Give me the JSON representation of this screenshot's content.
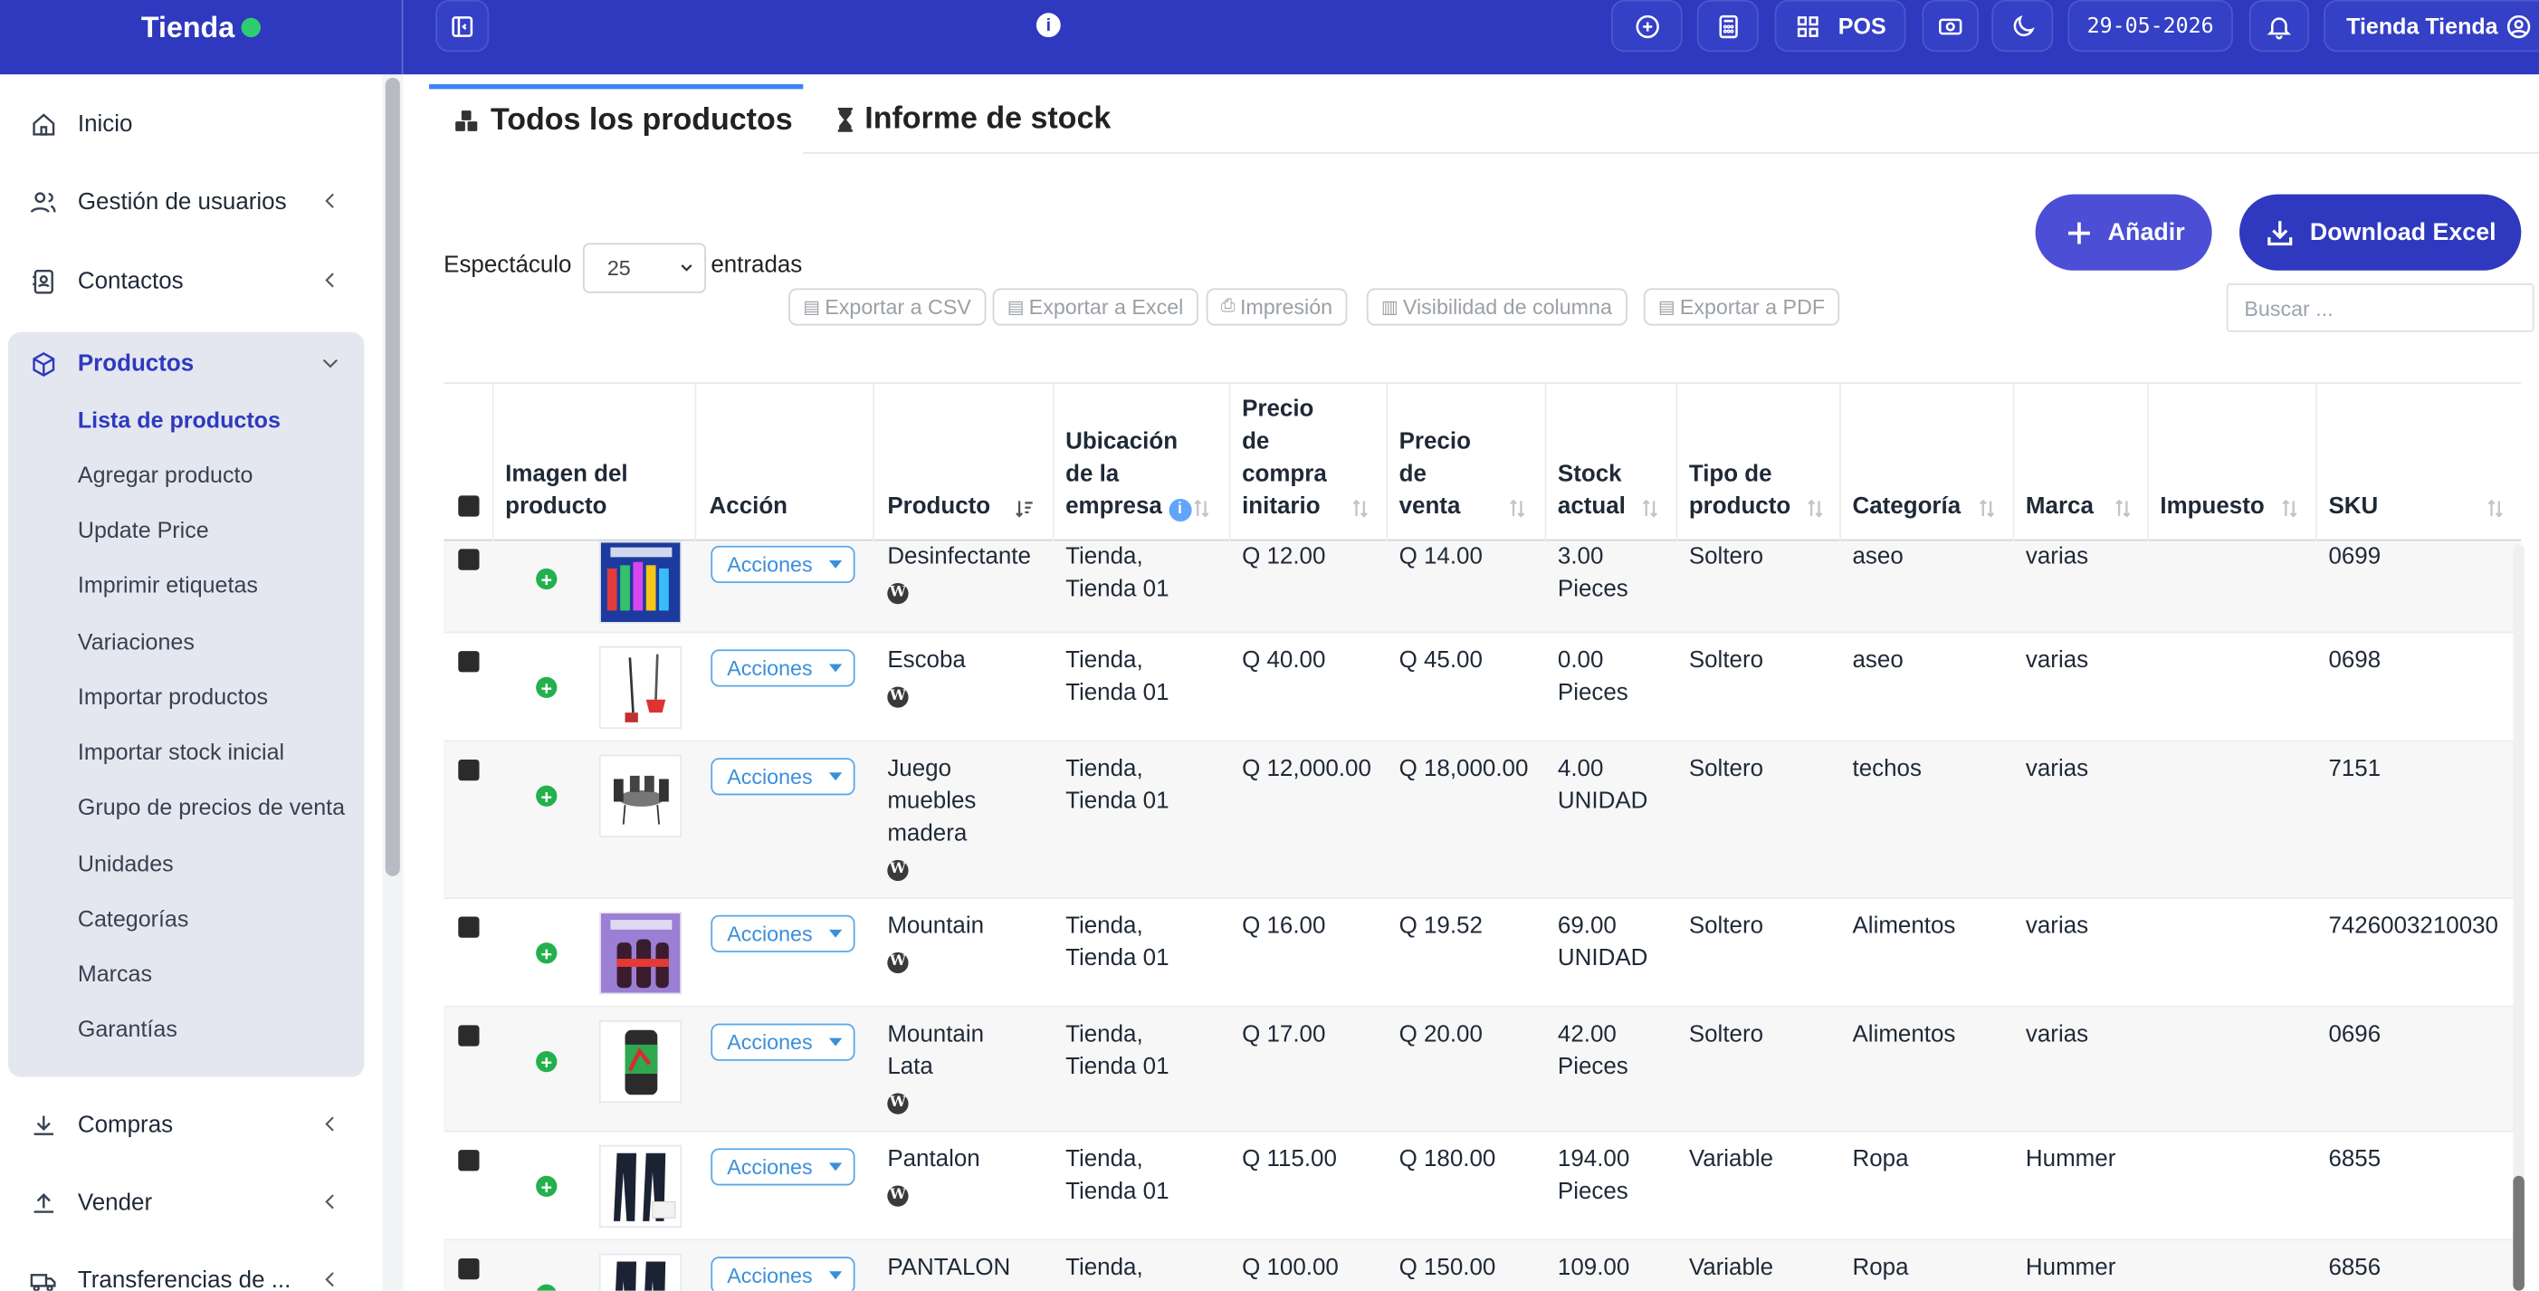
{
  "brand": {
    "name": "Tienda"
  },
  "topbar": {
    "pos_label": "POS",
    "date": "29-05-2026",
    "user": "Tienda Tienda",
    "info_glyph": "i"
  },
  "sidebar": {
    "items": [
      {
        "label": "Inicio",
        "icon": "home-icon"
      },
      {
        "label": "Gestión de usuarios",
        "icon": "users-icon"
      },
      {
        "label": "Contactos",
        "icon": "contacts-icon"
      },
      {
        "label": "Productos",
        "icon": "box-icon"
      },
      {
        "label": "Compras",
        "icon": "download-icon"
      },
      {
        "label": "Vender",
        "icon": "upload-icon"
      },
      {
        "label": "Transferencias de ...",
        "icon": "truck-icon"
      }
    ],
    "product_sub": [
      "Lista de productos",
      "Agregar producto",
      "Update Price",
      "Imprimir etiquetas",
      "Variaciones",
      "Importar productos",
      "Importar stock inicial",
      "Grupo de precios de venta",
      "Unidades",
      "Categorías",
      "Marcas",
      "Garantías"
    ]
  },
  "tabs": {
    "all_products": "Todos los productos",
    "stock_report": "Informe de stock"
  },
  "actions": {
    "add": "Añadir",
    "download_excel": "Download Excel"
  },
  "length": {
    "label": "Espectáculo",
    "value": "25",
    "suffix": "entradas"
  },
  "export": {
    "csv": "Exportar a CSV",
    "excel": "Exportar a Excel",
    "print": "Impresión",
    "colvis": "Visibilidad de columna",
    "pdf": "Exportar a PDF"
  },
  "search": {
    "placeholder": "Buscar ..."
  },
  "table": {
    "headers": {
      "image": "Imagen del producto",
      "action": "Acción",
      "product": "Producto",
      "location": "Ubicación de la empresa",
      "cost": "Precio de compra initario",
      "price": "Precio de venta",
      "stock": "Stock actual",
      "type": "Tipo de producto",
      "category": "Categoría",
      "brand": "Marca",
      "tax": "Impuesto",
      "sku": "SKU"
    },
    "action_label": "Acciones",
    "rows": [
      {
        "product": "Desinfectante",
        "location": "Tienda, Tienda 01",
        "cost": "Q 12.00",
        "price": "Q 14.00",
        "stock": "3.00 Pieces",
        "type": "Soltero",
        "category": "aseo",
        "brand": "varias",
        "tax": "",
        "sku": "0699"
      },
      {
        "product": "Escoba",
        "location": "Tienda, Tienda 01",
        "cost": "Q 40.00",
        "price": "Q 45.00",
        "stock": "0.00 Pieces",
        "type": "Soltero",
        "category": "aseo",
        "brand": "varias",
        "tax": "",
        "sku": "0698"
      },
      {
        "product": "Juego muebles madera",
        "location": "Tienda, Tienda 01",
        "cost": "Q 12,000.00",
        "price": "Q 18,000.00",
        "stock": "4.00 UNIDAD",
        "type": "Soltero",
        "category": "techos",
        "brand": "varias",
        "tax": "",
        "sku": "7151"
      },
      {
        "product": "Mountain",
        "location": "Tienda, Tienda 01",
        "cost": "Q 16.00",
        "price": "Q 19.52",
        "stock": "69.00 UNIDAD",
        "type": "Soltero",
        "category": "Alimentos",
        "brand": "varias",
        "tax": "",
        "sku": "7426003210030"
      },
      {
        "product": "Mountain Lata",
        "location": "Tienda, Tienda 01",
        "cost": "Q 17.00",
        "price": "Q 20.00",
        "stock": "42.00 Pieces",
        "type": "Soltero",
        "category": "Alimentos",
        "brand": "varias",
        "tax": "",
        "sku": "0696"
      },
      {
        "product": "Pantalon",
        "location": "Tienda, Tienda 01",
        "cost": "Q 115.00",
        "price": "Q 180.00",
        "stock": "194.00 Pieces",
        "type": "Variable",
        "category": "Ropa",
        "brand": "Hummer",
        "tax": "",
        "sku": "6855"
      },
      {
        "product": "PANTALON",
        "location": "Tienda,",
        "cost": "Q 100.00",
        "price": "Q 150.00",
        "stock": "109.00",
        "type": "Variable",
        "category": "Ropa",
        "brand": "Hummer",
        "tax": "",
        "sku": "6856"
      }
    ]
  },
  "colors": {
    "topbar": "#2e39bf",
    "accent": "#2e39bf",
    "add_button": "#4c4fd6",
    "status_online": "#2ecc71"
  }
}
